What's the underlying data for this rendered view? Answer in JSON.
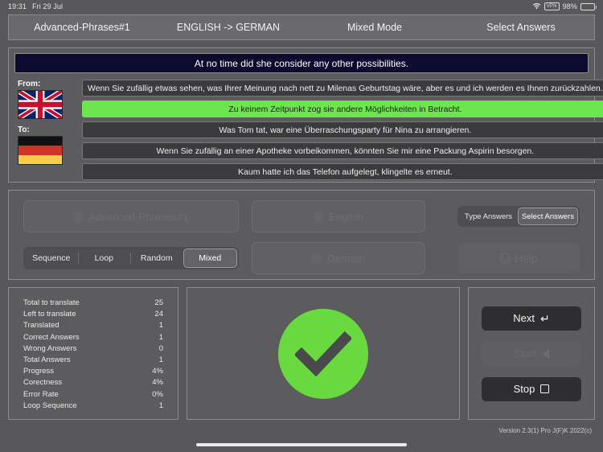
{
  "statusbar": {
    "time": "19:31",
    "date": "Fri 29 Jul",
    "wifi_icon": "wifi-icon",
    "vpn_label": "VPN",
    "battery_pct": "98%",
    "battery_icon": "battery-icon"
  },
  "topbar": {
    "tabs": [
      {
        "label": "Advanced-Phrases#1"
      },
      {
        "label": "ENGLISH -> GERMAN"
      },
      {
        "label": "Mixed Mode"
      },
      {
        "label": "Select Answers"
      }
    ]
  },
  "phrases": {
    "question": "At no time did she consider any other possibilities.",
    "from_label": "From:",
    "to_label": "To:",
    "from_flag": "flag-united-kingdom",
    "to_flag": "flag-germany",
    "answers": [
      {
        "text": "Wenn Sie zufällig etwas sehen, was Ihrer Meinung nach nett zu Milenas Geburtstag wäre, aber es und ich werden es Ihnen zurückzahlen.",
        "correct": false
      },
      {
        "text": "Zu keinem Zeitpunkt zog sie andere Möglichkeiten in Betracht.",
        "correct": true
      },
      {
        "text": "Was Tom tat, war eine Überraschungsparty für Nina zu arrangieren.",
        "correct": false
      },
      {
        "text": "Wenn Sie zufällig an einer Apotheke vorbeikommen, könnten Sie mir eine Packung Aspirin besorgen.",
        "correct": false
      },
      {
        "text": "Kaum hatte ich das Telefon aufgelegt, klingelte es erneut.",
        "correct": false
      }
    ]
  },
  "settings": {
    "lesson_dropdown": "Advanced-Phrases#1",
    "from_language_dropdown": "English",
    "to_language_dropdown": "German",
    "mode_segments": [
      {
        "label": "Sequence",
        "active": false
      },
      {
        "label": "Loop",
        "active": false
      },
      {
        "label": "Random",
        "active": false
      },
      {
        "label": "Mixed",
        "active": true
      }
    ],
    "answer_segments": [
      {
        "label": "Type Answers",
        "active": false
      },
      {
        "label": "Select Answers",
        "active": true
      }
    ],
    "help_label": "Help",
    "help_icon": "question-mark-icon"
  },
  "stats": [
    {
      "label": "Total to translate",
      "value": "25"
    },
    {
      "label": "Left to translate",
      "value": "24"
    },
    {
      "label": "Translated",
      "value": "1"
    },
    {
      "label": "Correct Answers",
      "value": "1"
    },
    {
      "label": "Wrong Answers",
      "value": "0"
    },
    {
      "label": "Total Answers",
      "value": "1"
    },
    {
      "label": "Progress",
      "value": "4%"
    },
    {
      "label": "Corectness",
      "value": "4%"
    },
    {
      "label": "Error Rate",
      "value": "0%"
    },
    {
      "label": "Loop Sequence",
      "value": "1"
    }
  ],
  "feedback": {
    "icon": "checkmark-circle-icon",
    "color": "#68d93f"
  },
  "buttons": {
    "next": {
      "label": "Next",
      "icon": "return-arrow-icon",
      "disabled": false
    },
    "start": {
      "label": "Start",
      "icon": "play-triangle-icon",
      "disabled": true
    },
    "stop": {
      "label": "Stop",
      "icon": "stop-square-icon",
      "disabled": false
    }
  },
  "footer": {
    "version": "Version 2.3(1) Pro J(F)K 2022(c)"
  }
}
